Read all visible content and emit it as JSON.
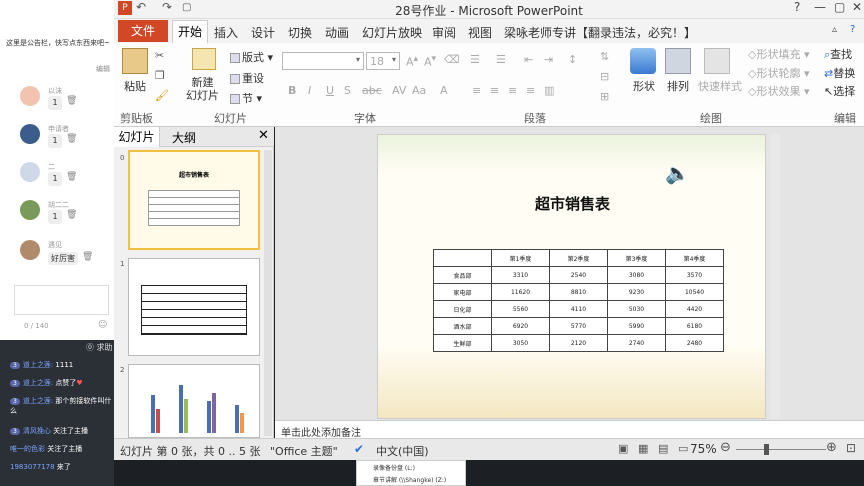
{
  "chat": {
    "notice": "这里是公告栏，快写点东西来吧~",
    "edit": "编辑",
    "rows": [
      {
        "name": "以沫",
        "badge": "1"
      },
      {
        "name": "申请者",
        "badge": "1"
      },
      {
        "name": "二",
        "badge": "1"
      },
      {
        "name": "胡二二",
        "badge": "1"
      },
      {
        "name": "遇见",
        "badge": "好厉害"
      }
    ],
    "counter": "0 / 140",
    "help": "求助",
    "messages": [
      {
        "user": "道上之莲:",
        "text": "1111"
      },
      {
        "user": "道上之莲:",
        "text": "点赞了"
      },
      {
        "user": "道上之莲:",
        "text": "那个剪接软件叫什么"
      },
      {
        "user": "清风挽心",
        "text": "关注了主播"
      },
      {
        "user": "唯一的色彩",
        "text": "关注了主播"
      },
      {
        "user": "1983077178",
        "text": "来了"
      }
    ]
  },
  "window": {
    "title": "28号作业 - Microsoft PowerPoint"
  },
  "tabs": {
    "file": "文件",
    "home": "开始",
    "items": [
      "插入",
      "设计",
      "切换",
      "动画",
      "幻灯片放映",
      "审阅",
      "视图",
      "梁咏老师专讲【翻录违法，必究！】"
    ]
  },
  "ribbon": {
    "paste": "粘贴",
    "new_slide": "新建\n幻灯片",
    "layout": "版式",
    "reset": "重设",
    "section": "节",
    "font_size": "18",
    "shape": "形状",
    "arrange": "排列",
    "quick_style": "快速样式",
    "fill": "形状填充",
    "outline": "形状轮廓",
    "effect": "形状效果",
    "find": "查找",
    "replace": "替换",
    "select": "选择",
    "groups": {
      "clipboard": "剪贴板",
      "slides": "幻灯片",
      "font": "字体",
      "paragraph": "段落",
      "drawing": "绘图",
      "edit": "编辑"
    }
  },
  "pane": {
    "tab_slides": "幻灯片",
    "tab_outline": "大纲",
    "nums": [
      "0",
      "1",
      "2"
    ]
  },
  "slide": {
    "title": "超市销售表",
    "header": [
      "",
      "第1季度",
      "第2季度",
      "第3季度",
      "第4季度"
    ],
    "rows": [
      [
        "食品部",
        "3310",
        "2540",
        "3080",
        "3570"
      ],
      [
        "家电部",
        "11620",
        "8810",
        "9230",
        "10540"
      ],
      [
        "日化部",
        "5560",
        "4110",
        "5030",
        "4420"
      ],
      [
        "酒水部",
        "6920",
        "5770",
        "5990",
        "6180"
      ],
      [
        "生鲜部",
        "3050",
        "2120",
        "2740",
        "2480"
      ]
    ]
  },
  "notes": "单击此处添加备注",
  "status": {
    "slide_info": "幻灯片 第 0 张，共 0 .. 5 张",
    "theme": "\"Office 主题\"",
    "lang": "中文(中国)",
    "zoom": "75%"
  },
  "taskbar": {
    "item1": "录像备份盘 (L:)",
    "item2": "章节讲解 (\\\\Shangke) (Z:)"
  }
}
